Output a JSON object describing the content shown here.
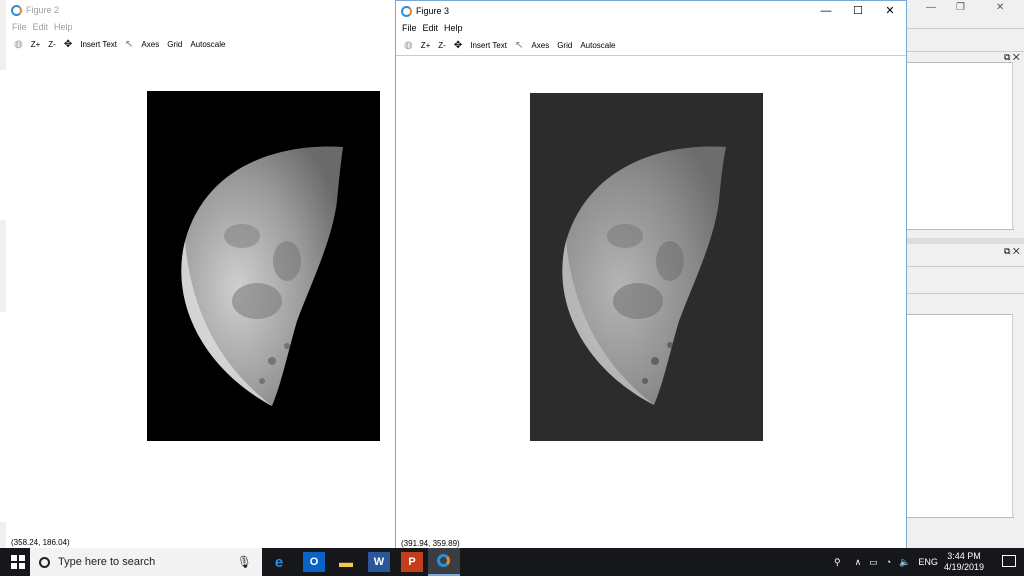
{
  "figure2": {
    "title": "Figure 2",
    "menu": [
      "File",
      "Edit",
      "Help"
    ],
    "toolbar": {
      "zoom_in": "Z+",
      "zoom_out": "Z-",
      "insert_text": "Insert Text",
      "axes": "Axes",
      "grid": "Grid",
      "autoscale": "Autoscale"
    },
    "status": "(358.24, 186.04)"
  },
  "figure3": {
    "title": "Figure 3",
    "menu": [
      "File",
      "Edit",
      "Help"
    ],
    "toolbar": {
      "zoom_in": "Z+",
      "zoom_out": "Z-",
      "insert_text": "Insert Text",
      "axes": "Axes",
      "grid": "Grid",
      "autoscale": "Autoscale"
    },
    "status": "(391.94, 359.89)",
    "controls": {
      "minimize": "—",
      "maximize": "☐",
      "close": "✕"
    }
  },
  "taskbar": {
    "search_placeholder": "Type here to search",
    "language": "ENG",
    "time": "3:44 PM",
    "date": "4/19/2019"
  },
  "colors": {
    "taskbar": "#15171a",
    "window_border": "#7aa7d4",
    "image_bg_fig2": "#000000",
    "image_bg_fig3": "#2c2c2c"
  }
}
